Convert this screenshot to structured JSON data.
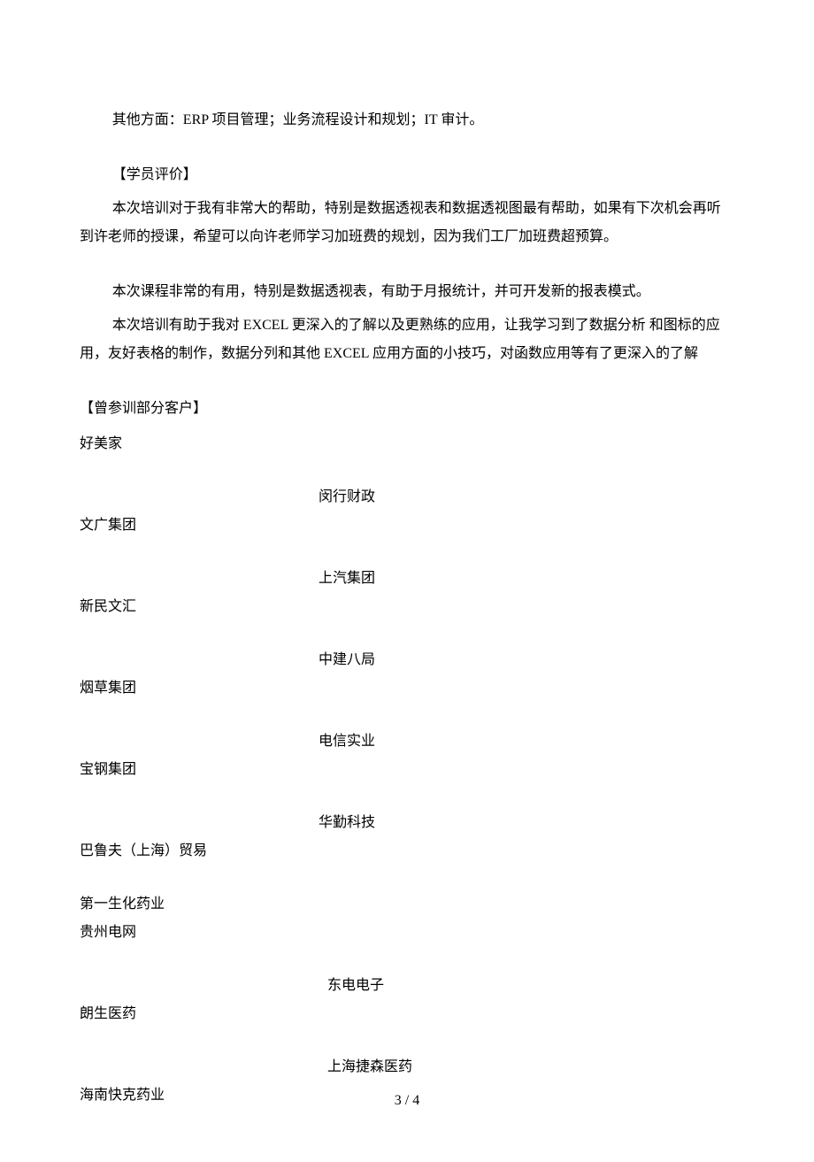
{
  "content": {
    "other_aspects": "其他方面：ERP 项目管理；业务流程设计和规划；IT 审计。",
    "feedback_header": "【学员评价】",
    "feedback_1": "本次培训对于我有非常大的帮助，特别是数据透视表和数据透视图最有帮助，如果有下次机会再听到许老师的授课，希望可以向许老师学习加班费的规划，因为我们工厂加班费超预算。",
    "feedback_2": "本次课程非常的有用，特别是数据透视表，有助于月报统计，并可开发新的报表模式。",
    "feedback_3": "本次培训有助于我对 EXCEL 更深入的了解以及更熟练的应用，让我学习到了数据分析 和图标的应用，友好表格的制作，数据分列和其他 EXCEL 应用方面的小技巧，对函数应用等有了更深入的了解",
    "clients_header": "【曾参训部分客户】",
    "clients": {
      "c1": "好美家",
      "c2": "闵行财政",
      "c3": "文广集团",
      "c4": "上汽集团",
      "c5": "新民文汇",
      "c6": "中建八局",
      "c7": "烟草集团",
      "c8": "电信实业",
      "c9": "宝钢集团",
      "c10": "华勤科技",
      "c11": "巴鲁夫（上海）贸易",
      "c12": "第一生化药业",
      "c13": "贵州电网",
      "c14": "东电电子",
      "c15": "朗生医药",
      "c16": "上海捷森医药",
      "c17": "海南快克药业"
    }
  },
  "footer": {
    "page_number": "3 / 4"
  }
}
